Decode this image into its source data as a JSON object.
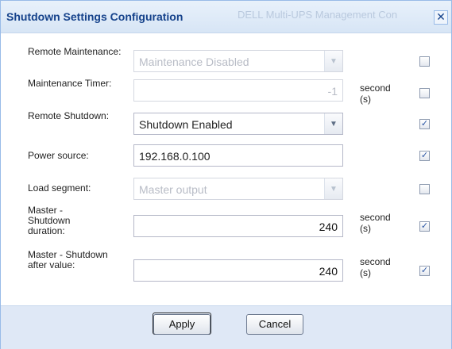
{
  "dialog": {
    "title": "Shutdown Settings Configuration",
    "background_title": "DELL Multi-UPS Management Con",
    "close_label": "✕"
  },
  "rows": [
    {
      "label": "Remote Maintenance:",
      "value": "Maintenance Disabled",
      "type": "select",
      "disabled": true,
      "unit": "",
      "checked": false
    },
    {
      "label": "Maintenance Timer:",
      "value": "-1",
      "type": "number",
      "disabled": true,
      "unit": "second (s)",
      "checked": false
    },
    {
      "label": "Remote Shutdown:",
      "value": "Shutdown Enabled",
      "type": "select",
      "disabled": false,
      "unit": "",
      "checked": true
    },
    {
      "label": "Power source:",
      "value": "192.168.0.100",
      "type": "text",
      "disabled": false,
      "unit": "",
      "checked": true
    },
    {
      "label": "Load segment:",
      "value": "Master output",
      "type": "select",
      "disabled": true,
      "unit": "",
      "checked": false
    },
    {
      "label": "Master - Shutdown duration:",
      "value": "240",
      "type": "number",
      "disabled": false,
      "unit": "second (s)",
      "checked": true
    },
    {
      "label": "Master - Shutdown after value:",
      "value": "240",
      "type": "number",
      "disabled": false,
      "unit": "second (s)",
      "checked": true
    }
  ],
  "footer": {
    "apply_label": "Apply",
    "cancel_label": "Cancel"
  },
  "colors": {
    "accent": "#15428b",
    "border": "#99bbe8",
    "footer_bg": "#dfe8f6"
  }
}
